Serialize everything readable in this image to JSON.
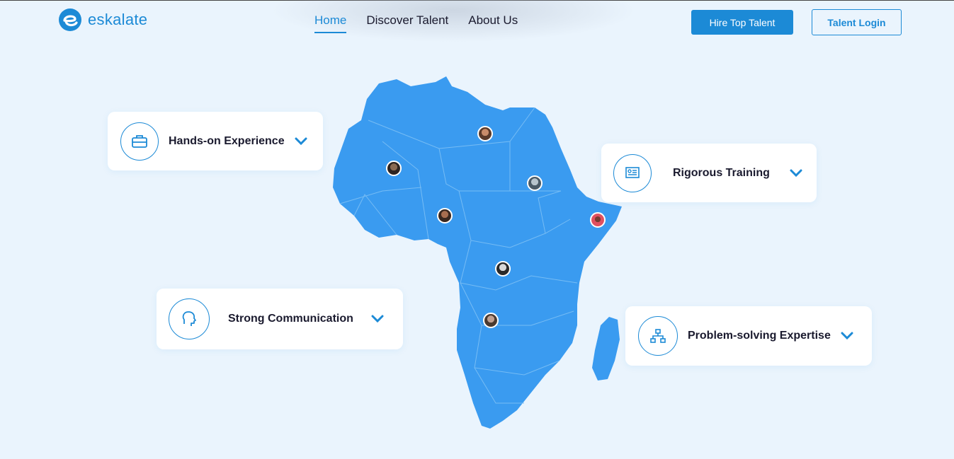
{
  "brand": {
    "name": "eskalate",
    "color": "#1c8ad6"
  },
  "nav": {
    "items": [
      "Home",
      "Discover Talent",
      "About Us"
    ],
    "active": "Home"
  },
  "header": {
    "primary_button": "Hire Top Talent",
    "outline_button": "Talent Login"
  },
  "features": [
    {
      "label": "Hands-on Experience",
      "icon": "briefcase-icon"
    },
    {
      "label": "Rigorous Training",
      "icon": "certificate-icon"
    },
    {
      "label": "Strong Communication",
      "icon": "head-speaking-icon"
    },
    {
      "label": "Problem-solving Expertise",
      "icon": "hierarchy-icon"
    }
  ],
  "map": {
    "region": "Africa",
    "fill": "#3a9bf0"
  }
}
